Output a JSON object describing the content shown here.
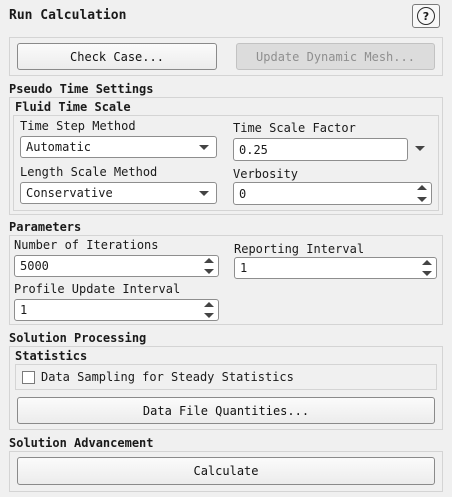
{
  "panel": {
    "title": "Run Calculation",
    "help_icon": "?"
  },
  "top_buttons": {
    "check_case": "Check Case...",
    "update_mesh": "Update Dynamic Mesh..."
  },
  "pseudo_time": {
    "section": "Pseudo Time Settings",
    "subsection": "Fluid Time Scale",
    "time_step_method_label": "Time Step Method",
    "time_step_method_value": "Automatic",
    "time_scale_factor_label": "Time Scale Factor",
    "time_scale_factor_value": "0.25",
    "length_scale_method_label": "Length Scale Method",
    "length_scale_method_value": "Conservative",
    "verbosity_label": "Verbosity",
    "verbosity_value": "0"
  },
  "parameters": {
    "section": "Parameters",
    "iterations_label": "Number of Iterations",
    "iterations_value": "5000",
    "reporting_label": "Reporting Interval",
    "reporting_value": "1",
    "profile_label": "Profile Update Interval",
    "profile_value": "1"
  },
  "solution_processing": {
    "section": "Solution Processing",
    "statistics_label": "Statistics",
    "data_sampling_label": "Data Sampling for Steady Statistics",
    "data_sampling_checked": false,
    "data_file_button": "Data File Quantities..."
  },
  "advancement": {
    "section": "Solution Advancement",
    "calculate_button": "Calculate"
  }
}
